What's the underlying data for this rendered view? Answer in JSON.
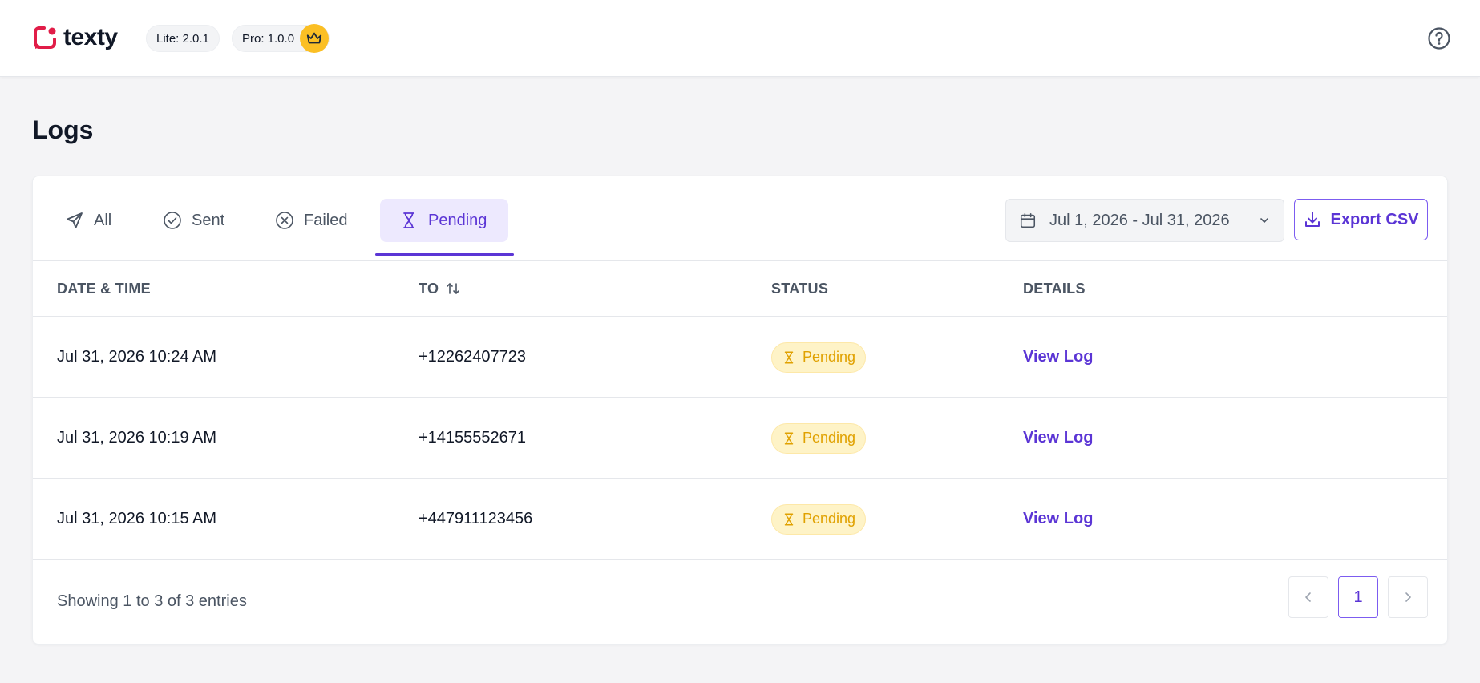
{
  "app": {
    "logo_text": "texty",
    "versions": {
      "lite": "Lite: 2.0.1",
      "pro": "Pro: 1.0.0"
    }
  },
  "page": {
    "title": "Logs"
  },
  "tabs": [
    {
      "label": "All",
      "icon": "send-icon"
    },
    {
      "label": "Sent",
      "icon": "check-circle-icon"
    },
    {
      "label": "Failed",
      "icon": "x-circle-icon"
    },
    {
      "label": "Pending",
      "icon": "hourglass-icon",
      "active": true
    }
  ],
  "filters": {
    "date_range": "Jul 1, 2026 - Jul 31, 2026",
    "export_label": "Export CSV"
  },
  "table": {
    "headers": {
      "date": "DATE & TIME",
      "to": "TO",
      "status": "STATUS",
      "details": "DETAILS"
    },
    "rows": [
      {
        "date": "Jul 31, 2026 10:24 AM",
        "to": "+12262407723",
        "status": "Pending",
        "details": "View Log"
      },
      {
        "date": "Jul 31, 2026 10:19 AM",
        "to": "+14155552671",
        "status": "Pending",
        "details": "View Log"
      },
      {
        "date": "Jul 31, 2026 10:15 AM",
        "to": "+447911123456",
        "status": "Pending",
        "details": "View Log"
      }
    ]
  },
  "pagination": {
    "summary": "Showing 1 to 3 of 3 entries",
    "current_page": "1"
  },
  "colors": {
    "brand": "#e11d48",
    "accent": "#5b35d5",
    "pending": "#e0a100",
    "crown": "#fbbf24"
  }
}
